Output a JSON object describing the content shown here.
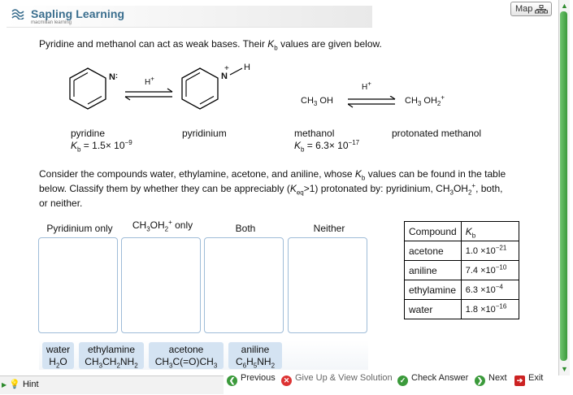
{
  "brand": {
    "name": "Sapling Learning",
    "sub": "macmillan learning"
  },
  "map_label": "Map",
  "intro": "Pyridine and methanol can act as weak bases. Their K values are given below.",
  "intro_parts": {
    "before": "Pyridine and methanol can act as weak bases. Their ",
    "k": "K",
    "b": "b",
    "after": " values are given below."
  },
  "reactions": {
    "pyridine": {
      "name": "pyridine",
      "kb_prefix": "K",
      "kb_sub": "b",
      "kb_val": " = 1.5× 10",
      "kb_exp": "−9"
    },
    "pyridinium": {
      "name": "pyridinium"
    },
    "methanol": {
      "name": "methanol",
      "formula": "CH",
      "formula_sub": "3",
      "formula_end": " OH",
      "kb_prefix": "K",
      "kb_sub": "b",
      "kb_val": " = 6.3× 10",
      "kb_exp": "−17"
    },
    "protonated_methanol": {
      "name": "protonated methanol",
      "formula": "CH",
      "formula_sub": "3",
      "formula_mid": " OH",
      "formula_sub2": "2",
      "formula_sup": "+"
    },
    "h_plus": "H",
    "h_plus_sup": "+",
    "n_label": "N",
    "n_charge": "+",
    "n_h": "H"
  },
  "question": {
    "p1": "Consider the compounds water, ethylamine, acetone, and aniline, whose ",
    "k": "K",
    "b": "b",
    "p2": " values can be found in the table",
    "p3": "below. Classify them by whether they can be appreciably (",
    "keq_k": "K",
    "keq_sub": "eq",
    "p4": ">1) protonated by: pyridinium, CH",
    "p4_sub": "3",
    "p4_mid": "OH",
    "p4_sub2": "2",
    "p4_sup": "+",
    "p5": ", both,",
    "p6": "or neither."
  },
  "zones": [
    {
      "label": "Pyridinium only"
    },
    {
      "label_pre": "CH",
      "label_sub": "3",
      "label_mid": "OH",
      "label_sub2": "2",
      "label_sup": "+",
      "label_post": " only"
    },
    {
      "label": "Both"
    },
    {
      "label": "Neither"
    }
  ],
  "chips": [
    {
      "name": "water",
      "f1": "H",
      "s1": "2",
      "f2": "O"
    },
    {
      "name": "ethylamine",
      "f1": "CH",
      "s1": "3",
      "f2": "CH",
      "s2": "2",
      "f3": "NH",
      "s3": "2"
    },
    {
      "name": "acetone",
      "f1": "CH",
      "s1": "3",
      "f2": "C(=O)CH",
      "s2": "3"
    },
    {
      "name": "aniline",
      "f1": "C",
      "s1": "6",
      "f2": "H",
      "s2": "5",
      "f3": "NH",
      "s3": "2"
    }
  ],
  "table": {
    "header_compound": "Compound",
    "header_k": "K",
    "header_sub": "b",
    "rows": [
      {
        "compound": "acetone",
        "mant": "1.0 ×10",
        "exp": "−21"
      },
      {
        "compound": "aniline",
        "mant": "7.4 ×10",
        "exp": "−10"
      },
      {
        "compound": "ethylamine",
        "mant": "6.3 ×10",
        "exp": "−4"
      },
      {
        "compound": "water",
        "mant": "1.8 ×10",
        "exp": "−16"
      }
    ]
  },
  "footer": {
    "hint": "Hint",
    "previous": "Previous",
    "give_up": "Give Up & View Solution",
    "check": "Check Answer",
    "next": "Next",
    "exit": "Exit"
  },
  "colors": {
    "brand": "#3a6e8e",
    "green": "#3b9a3b",
    "zone_border": "#9fbcd8",
    "chip": "#d4e3f2"
  }
}
